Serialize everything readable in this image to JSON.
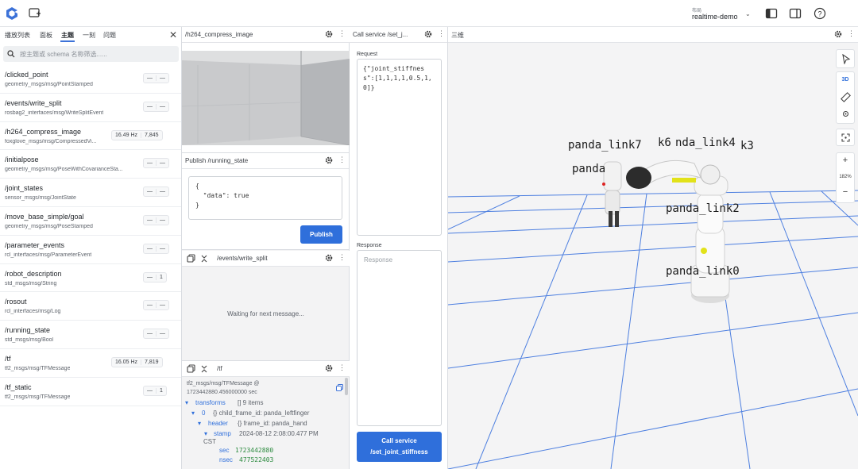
{
  "topbar": {
    "layout_caption": "布局",
    "layout_name": "realtime-demo",
    "icons": [
      "foxglove-logo-icon",
      "add-panel-icon",
      "left-sidebar-icon",
      "right-sidebar-icon",
      "help-icon"
    ]
  },
  "left_panel": {
    "tabs": [
      "播放列表",
      "面板",
      "主题",
      "一刻",
      "问题"
    ],
    "active_tab": "主题",
    "search_placeholder": "按主题或 schema 名称筛选......",
    "topics": [
      {
        "name": "/clicked_point",
        "schema": "geometry_msgs/msg/PointStamped",
        "freq": "—",
        "count": "—"
      },
      {
        "name": "/events/write_split",
        "schema": "rosbag2_interfaces/msg/WriteSplitEvent",
        "freq": "—",
        "count": "—"
      },
      {
        "name": "/h264_compress_image",
        "schema": "foxglove_msgs/msg/CompressedVi...",
        "freq": "16.49 Hz",
        "count": "7,845"
      },
      {
        "name": "/initialpose",
        "schema": "geometry_msgs/msg/PoseWithCovarianceSta...",
        "freq": "—",
        "count": "—"
      },
      {
        "name": "/joint_states",
        "schema": "sensor_msgs/msg/JointState",
        "freq": "—",
        "count": "—"
      },
      {
        "name": "/move_base_simple/goal",
        "schema": "geometry_msgs/msg/PoseStamped",
        "freq": "—",
        "count": "—"
      },
      {
        "name": "/parameter_events",
        "schema": "rcl_interfaces/msg/ParameterEvent",
        "freq": "—",
        "count": "—"
      },
      {
        "name": "/robot_description",
        "schema": "std_msgs/msg/String",
        "freq": "—",
        "count": "1"
      },
      {
        "name": "/rosout",
        "schema": "rcl_interfaces/msg/Log",
        "freq": "—",
        "count": "—"
      },
      {
        "name": "/running_state",
        "schema": "std_msgs/msg/Bool",
        "freq": "—",
        "count": "—"
      },
      {
        "name": "/tf",
        "schema": "tf2_msgs/msg/TFMessage",
        "freq": "16.05 Hz",
        "count": "7,819"
      },
      {
        "name": "/tf_static",
        "schema": "tf2_msgs/msg/TFMessage",
        "freq": "—",
        "count": "1"
      }
    ]
  },
  "image_panel": {
    "title": "/h264_compress_image"
  },
  "publish_panel": {
    "title": "Publish /running_state",
    "editor_text": "{\n  \"data\": true\n}",
    "button": "Publish"
  },
  "raw_panel_1": {
    "title": "/events/write_split",
    "waiting": "Waiting for next message..."
  },
  "raw_panel_2": {
    "title": "/tf",
    "meta_line1": "tf2_msgs/msg/TFMessage @",
    "meta_line2": "1723442880.456000000 sec",
    "transforms_key": "transforms",
    "transforms_summary": "[]  9 items",
    "item0_key": "0",
    "item0_summary": "{}  child_frame_id: panda_leftfinger",
    "header_key": "header",
    "header_summary": "{}  frame_id: panda_hand",
    "stamp_key": "stamp",
    "stamp_value": "2024-08-12 2:08:00.477 PM",
    "stamp_tz": "CST",
    "sec_key": "sec",
    "sec_value": "1723442880",
    "nsec_key": "nsec",
    "nsec_value": "477522403"
  },
  "service_panel": {
    "title": "Call service /set_j...",
    "request_label": "Request",
    "request_text": "{\"joint_stiffness\":[1,1,1,1,0.5,1,0]}",
    "response_label": "Response",
    "response_placeholder": "Response",
    "button_line1": "Call service",
    "button_line2": "/set_joint_stiffness"
  },
  "scene_panel": {
    "title": "三维",
    "toolbar": {
      "mode_3d": "3D",
      "zoom": "182%",
      "zoom_in": "+",
      "zoom_out": "−"
    },
    "frame_labels": [
      "panda_link7",
      "k6",
      "nda_link4",
      "k3",
      "panda",
      "panda_link2",
      "panda_link0"
    ]
  },
  "colors": {
    "accent": "#2f6fdb",
    "border": "#d9dce1"
  }
}
